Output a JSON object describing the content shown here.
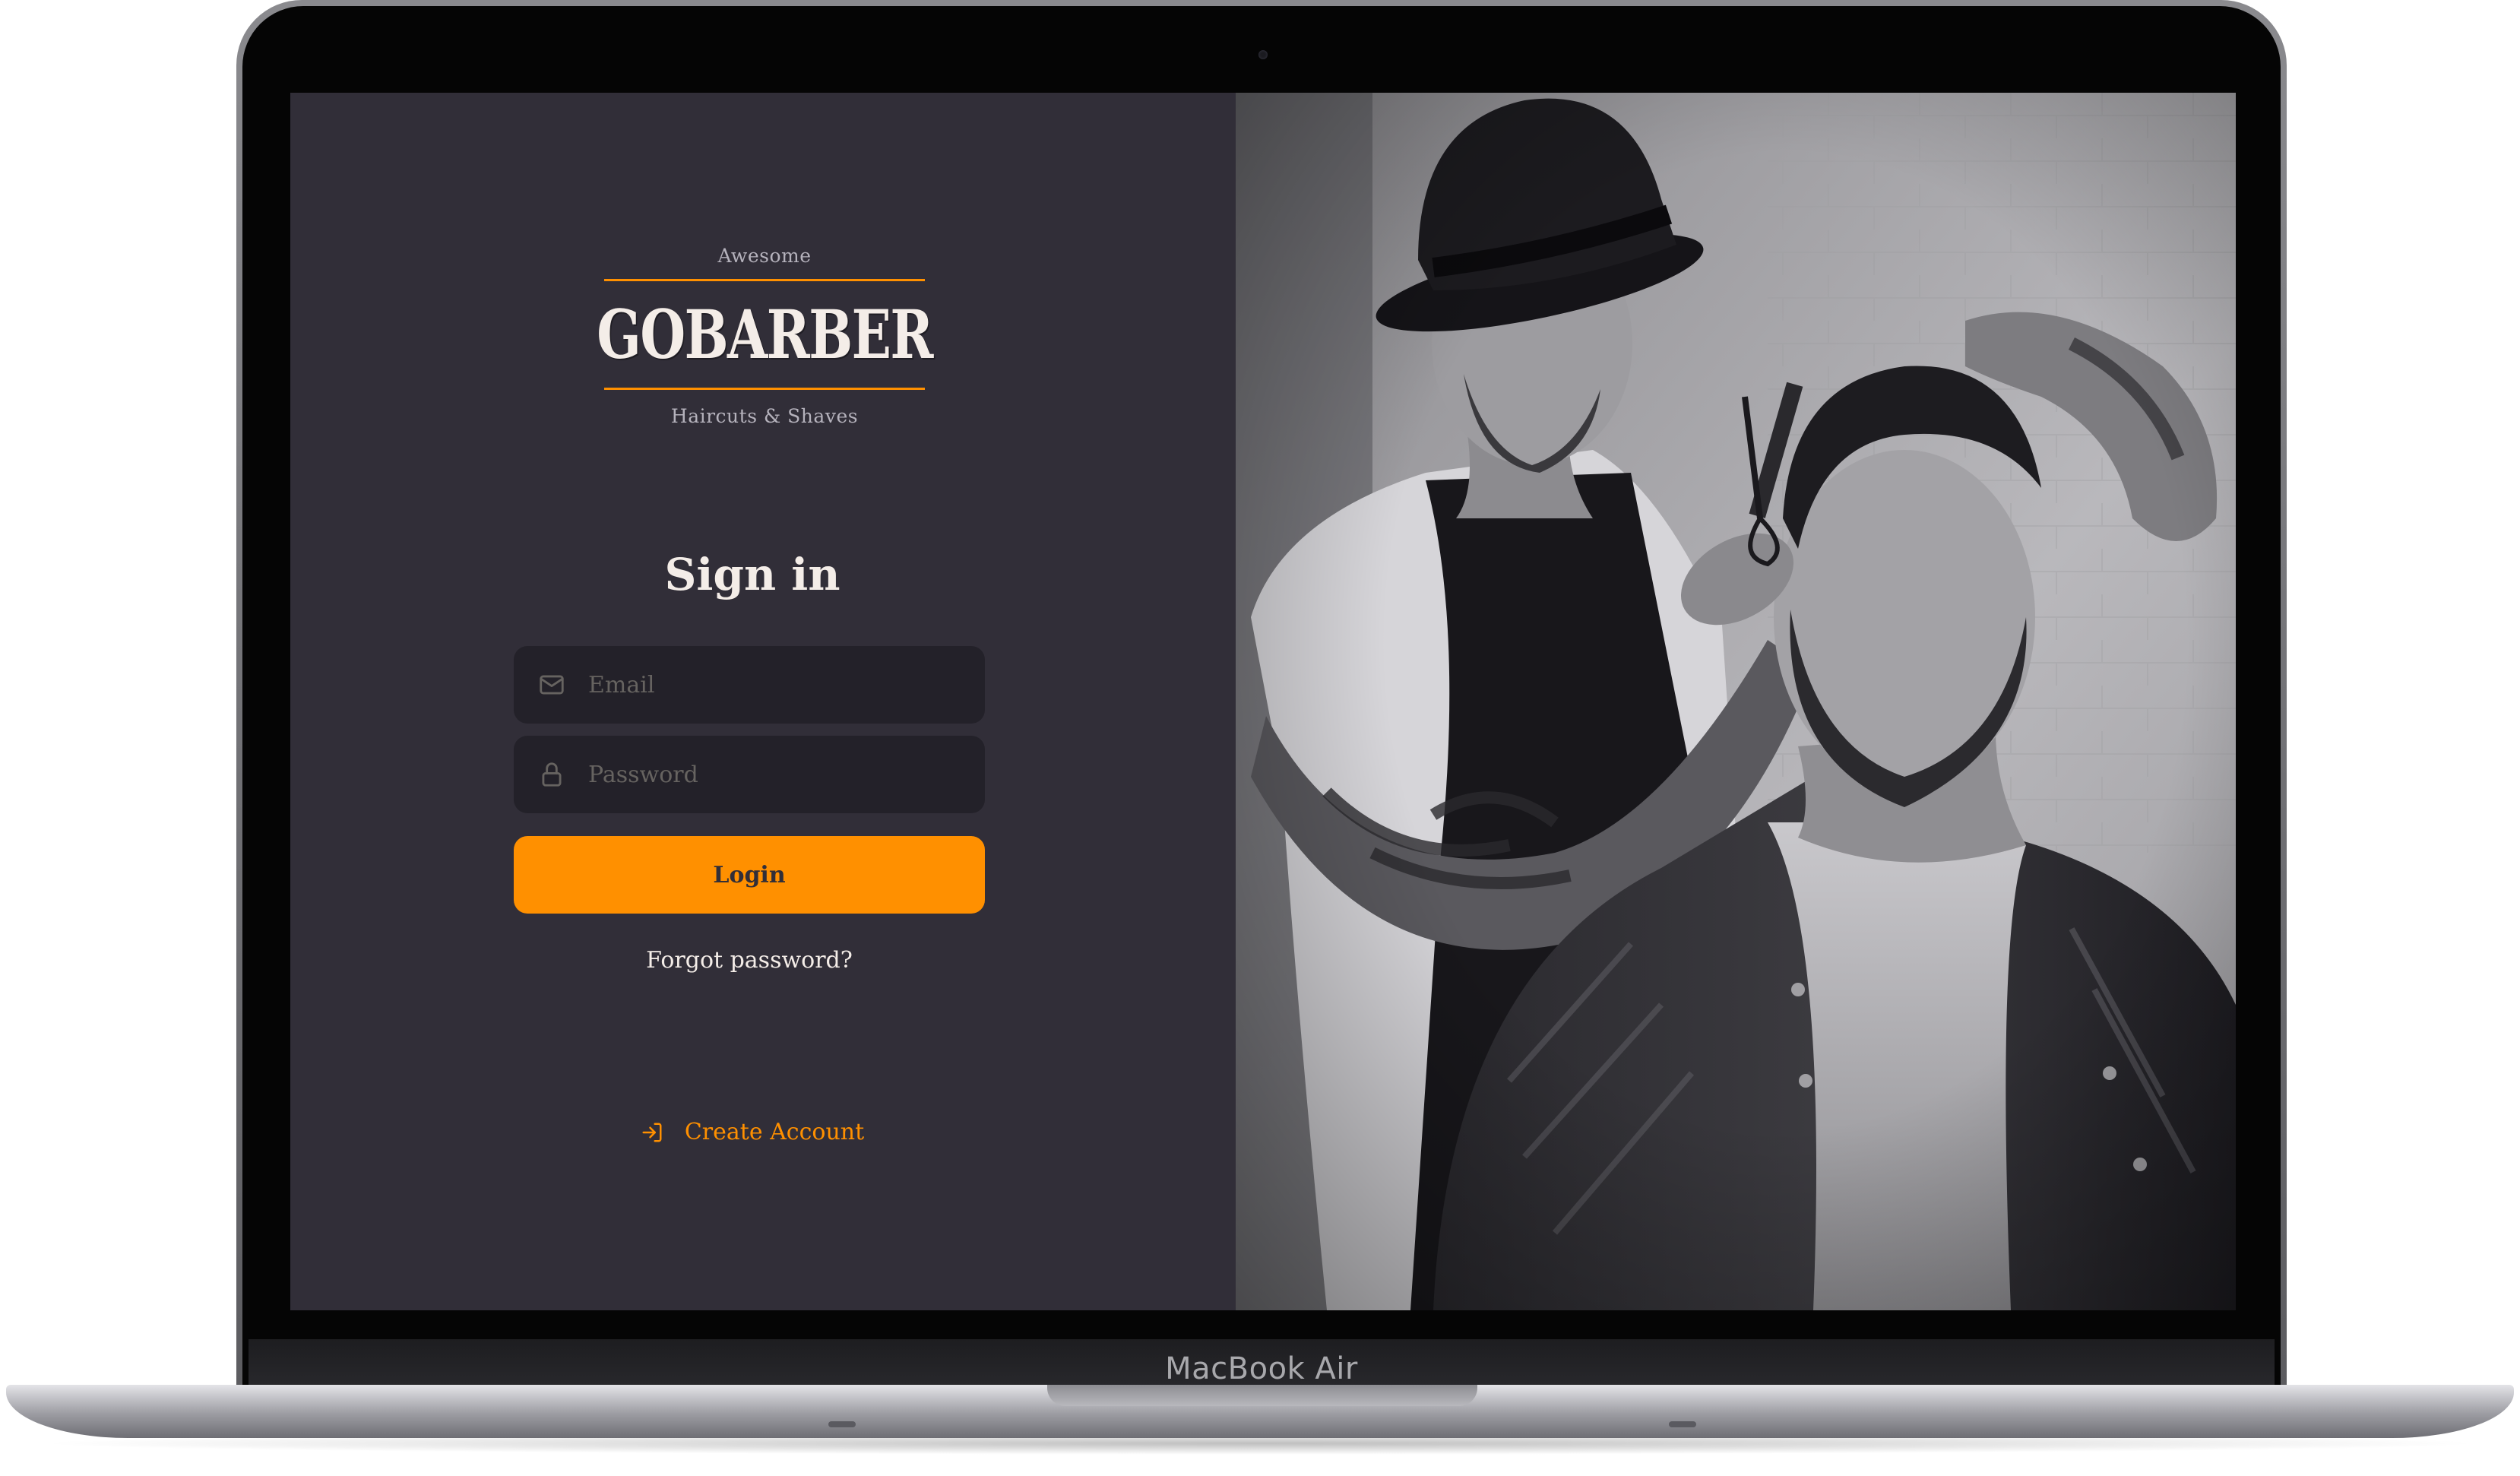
{
  "device": {
    "model_label": "MacBook Air"
  },
  "logo": {
    "tagline_top": "Awesome",
    "name": "GOBARBER",
    "tagline_bottom": "Haircuts & Shaves",
    "accent_color": "#ff9000"
  },
  "form": {
    "title": "Sign in",
    "email_placeholder": "Email",
    "password_placeholder": "Password",
    "email_icon": "mail-icon",
    "password_icon": "lock-icon",
    "submit_label": "Login",
    "forgot_label": "Forgot password?"
  },
  "footer": {
    "create_account_label": "Create Account",
    "create_account_icon": "log-in-icon"
  },
  "colors": {
    "background": "#312e38",
    "input_background": "#232129",
    "primary": "#ff9000",
    "text": "#f4ede8",
    "placeholder": "#666360"
  },
  "hero_image": {
    "subject": "barber-photo"
  }
}
